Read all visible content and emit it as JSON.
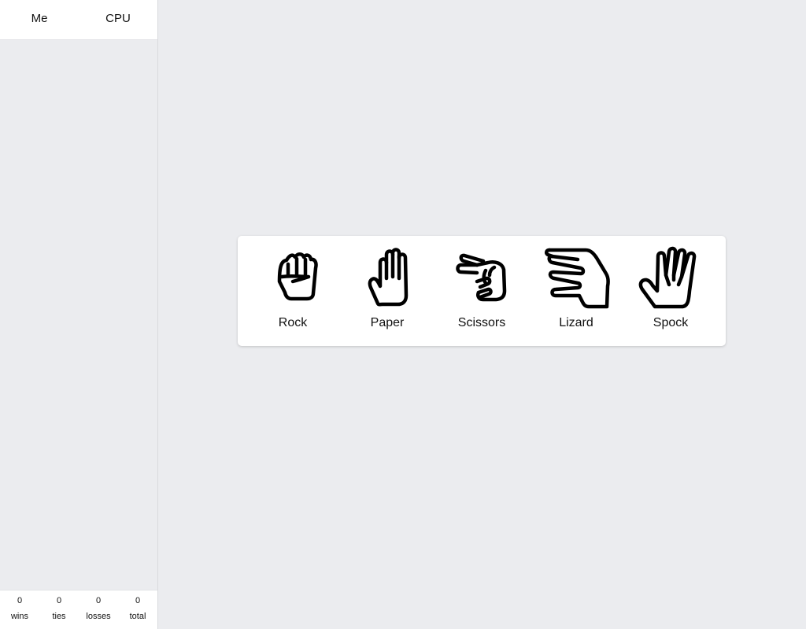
{
  "sidebar": {
    "players": {
      "me": "Me",
      "cpu": "CPU"
    },
    "scoreboard": [
      {
        "value": "0",
        "label": "wins"
      },
      {
        "value": "0",
        "label": "ties"
      },
      {
        "value": "0",
        "label": "losses"
      },
      {
        "value": "0",
        "label": "total"
      }
    ]
  },
  "choices": [
    {
      "label": "Rock",
      "icon": "rock-fist-icon"
    },
    {
      "label": "Paper",
      "icon": "paper-hand-icon"
    },
    {
      "label": "Scissors",
      "icon": "scissors-hand-icon"
    },
    {
      "label": "Lizard",
      "icon": "lizard-hand-icon"
    },
    {
      "label": "Spock",
      "icon": "spock-hand-icon"
    }
  ]
}
